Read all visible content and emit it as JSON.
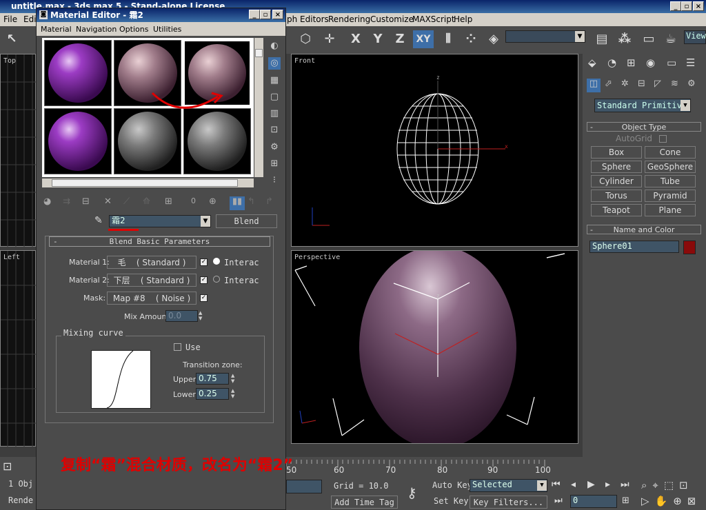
{
  "main_window": {
    "title": "untitle.max - 3ds max 5 - Stand-alone License",
    "menu": [
      "File",
      "Edit",
      "ph Editors",
      "Rendering",
      "Customize",
      "MAXScript",
      "Help"
    ],
    "toolbar_axes": [
      "X",
      "Y",
      "Z",
      "XY"
    ],
    "view_combo": "View"
  },
  "viewports": {
    "top_label": "Top",
    "left_label": "Left",
    "front_label": "Front",
    "perspective_label": "Perspective"
  },
  "command_panel": {
    "category": "Standard Primitiv",
    "object_type_header": "Object Type",
    "autogrid_label": "AutoGrid",
    "buttons": [
      "Box",
      "Cone",
      "Sphere",
      "GeoSphere",
      "Cylinder",
      "Tube",
      "Torus",
      "Pyramid",
      "Teapot",
      "Plane"
    ],
    "name_color_header": "Name and Color",
    "object_name": "Sphere01",
    "object_color": "#8a0a0a"
  },
  "bottom": {
    "object_count": "1 Obj",
    "render_label": "Rende",
    "timeline_ticks": [
      "60",
      "70",
      "80",
      "90",
      "100"
    ],
    "timeline_partial": "50",
    "grid": "Grid = 10.0",
    "add_time_tag": "Add Time Tag",
    "auto_key": "Auto Key",
    "set_key": "Set Key",
    "selected": "Selected",
    "key_filters": "Key Filters...",
    "frame": "0"
  },
  "material_editor": {
    "title": "Material Editor - 霜2",
    "menu": [
      "Material",
      "Navigation",
      "Options",
      "Utilities"
    ],
    "material_name": "霜2",
    "material_type": "Blend",
    "toolbar_value": "0",
    "rollout_title": "Blend Basic Parameters",
    "material1_label": "Material 1:",
    "material1_value": "毛    ( Standard )",
    "material2_label": "Material 2:",
    "material2_value": "下层    ( Standard )",
    "interactive_label": "Interac",
    "mask_label": "Mask:",
    "mask_value": "Map #8    ( Noise )",
    "mix_amount_label": "Mix Amount:",
    "mix_amount_value": "0.0",
    "mixing_curve_label": "Mixing curve",
    "use_label": "Use",
    "transition_zone_label": "Transition zone:",
    "upper_label": "Upper:",
    "upper_value": "0.75",
    "lower_label": "Lower:",
    "lower_value": "0.25"
  },
  "caption": "复制“霜”混合材质，改名为“霜2”",
  "colors": {
    "accent_red": "#e00000",
    "title_blue": "#0a246a"
  }
}
